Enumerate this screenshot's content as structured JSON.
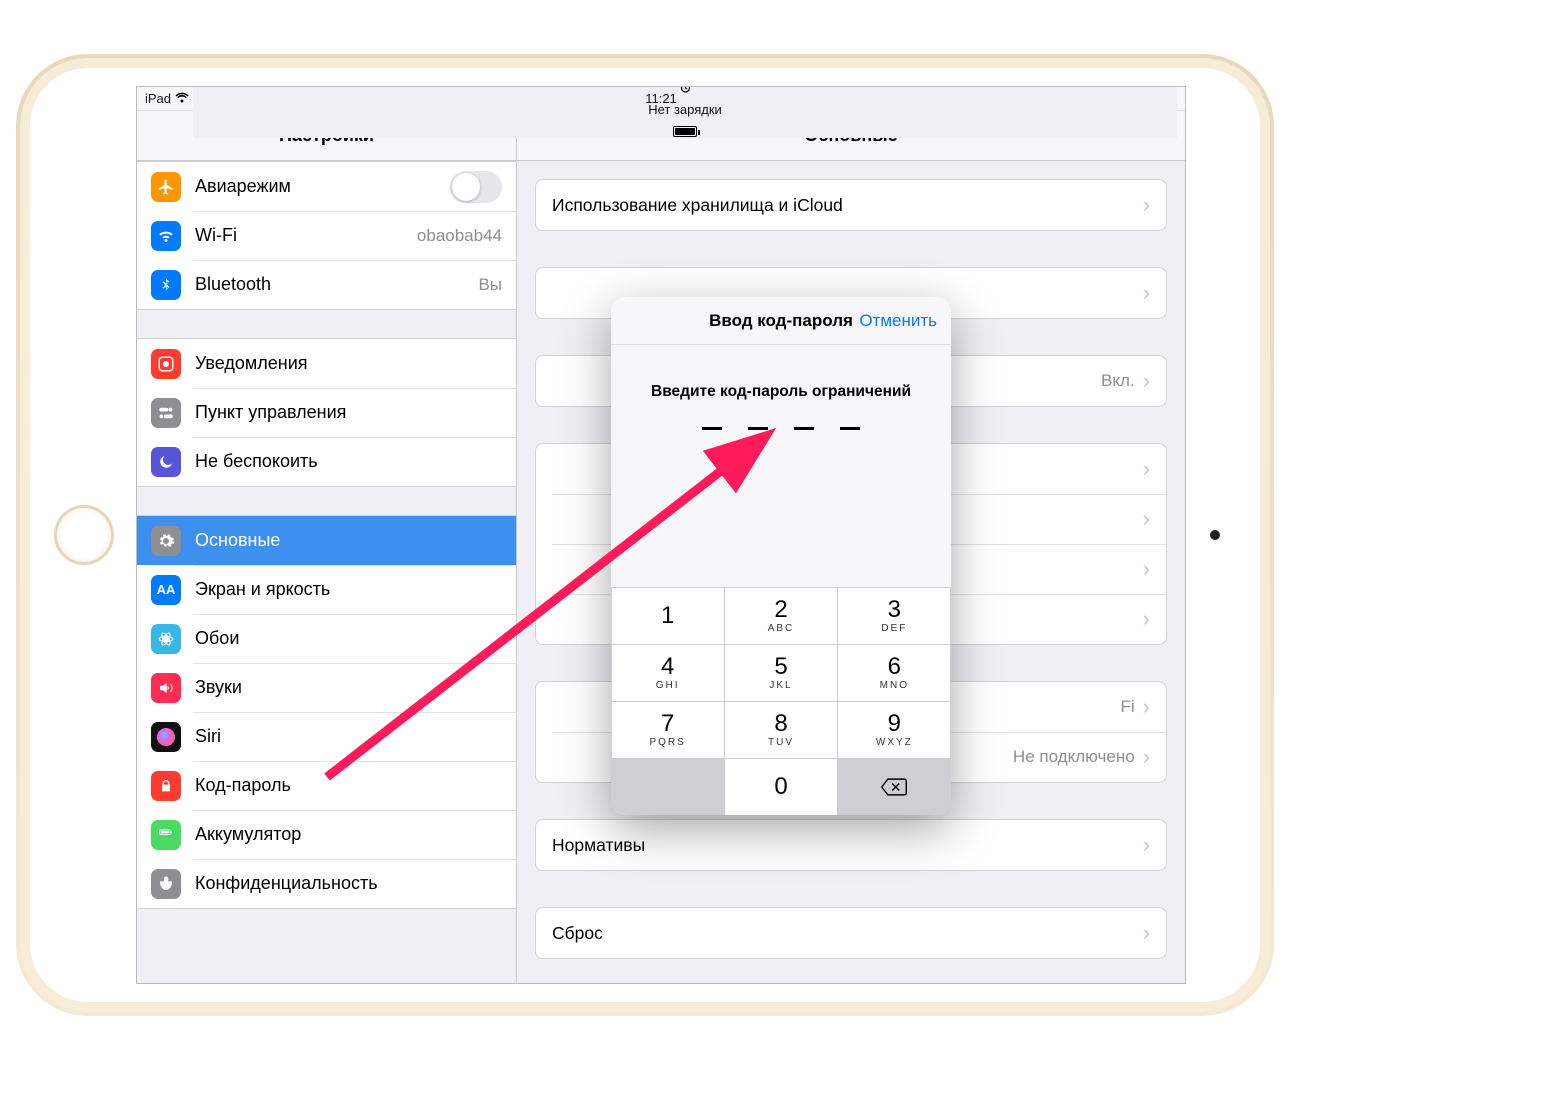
{
  "statusbar": {
    "device": "iPad",
    "time": "11:21",
    "status": "Нет зарядки"
  },
  "left_title": "Настройки",
  "right_title": "Основные",
  "sidebar": {
    "g1": [
      {
        "icon_bg": "#ff9500",
        "icon": "airplane",
        "label": "Авиарежим",
        "type": "switch"
      },
      {
        "icon_bg": "#007aff",
        "icon": "wifi",
        "label": "Wi-Fi",
        "trail": "obaobab44"
      },
      {
        "icon_bg": "#007aff",
        "icon": "bluetooth",
        "label": "Bluetooth",
        "trail": "Вы"
      }
    ],
    "g2": [
      {
        "icon_bg": "#ff3b30",
        "icon": "bell",
        "label": "Уведомления"
      },
      {
        "icon_bg": "#8e8e93",
        "icon": "toggles",
        "label": "Пункт управления"
      },
      {
        "icon_bg": "#5856d6",
        "icon": "moon",
        "label": "Не беспокоить"
      }
    ],
    "g3": [
      {
        "icon_bg": "#8e8e93",
        "icon": "gear",
        "label": "Основные",
        "selected": true
      },
      {
        "icon_bg": "#007aff",
        "icon": "aa",
        "label": "Экран и яркость"
      },
      {
        "icon_bg": "#38b7ea",
        "icon": "flower",
        "label": "Обои"
      },
      {
        "icon_bg": "#ff2d55",
        "icon": "speaker",
        "label": "Звуки"
      },
      {
        "icon_bg": "siri",
        "icon": "siri",
        "label": "Siri"
      },
      {
        "icon_bg": "#ff3b30",
        "icon": "lock",
        "label": "Код-пароль"
      },
      {
        "icon_bg": "#4cd964",
        "icon": "battery",
        "label": "Аккумулятор"
      },
      {
        "icon_bg": "#8e8e93",
        "icon": "hand",
        "label": "Конфиденциальность"
      }
    ]
  },
  "detail": {
    "g1": [
      {
        "label": "Использование хранилища и iCloud"
      }
    ],
    "g2": [
      {
        "label": ""
      }
    ],
    "g3": [
      {
        "label": "",
        "trail": "Вкл."
      }
    ],
    "g4": [
      {
        "label": ""
      },
      {
        "label": ""
      },
      {
        "label": ""
      },
      {
        "label": ""
      }
    ],
    "g5": [
      {
        "label": "",
        "trail_suffix": "Fi"
      },
      {
        "label": "",
        "trail": "Не подключено"
      }
    ],
    "g6": [
      {
        "label": "Нормативы"
      }
    ],
    "g7": [
      {
        "label": "Сброс"
      }
    ]
  },
  "modal": {
    "title": "Ввод код-пароля",
    "cancel": "Отменить",
    "prompt": "Введите код-пароль ограничений"
  },
  "keypad": [
    [
      {
        "d": "1",
        "s": ""
      },
      {
        "d": "2",
        "s": "ABC"
      },
      {
        "d": "3",
        "s": "DEF"
      }
    ],
    [
      {
        "d": "4",
        "s": "GHI"
      },
      {
        "d": "5",
        "s": "JKL"
      },
      {
        "d": "6",
        "s": "MNO"
      }
    ],
    [
      {
        "d": "7",
        "s": "PQRS"
      },
      {
        "d": "8",
        "s": "TUV"
      },
      {
        "d": "9",
        "s": "WXYZ"
      }
    ],
    [
      {
        "d": "",
        "s": "",
        "blank": true
      },
      {
        "d": "0",
        "s": ""
      },
      {
        "d": "",
        "s": "",
        "del": true
      }
    ]
  ]
}
